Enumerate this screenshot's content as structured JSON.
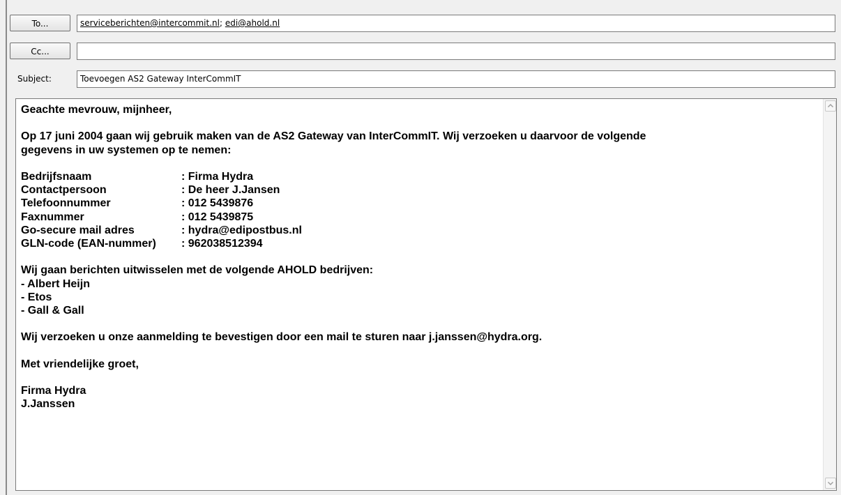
{
  "header": {
    "to_button": "To...",
    "to_recipients": [
      "serviceberichten@intercommit.nl",
      "edi@ahold.nl"
    ],
    "to_separator": "; ",
    "cc_button": "Cc...",
    "cc_value": "",
    "subject_label": "Subject:",
    "subject_value": "Toevoegen AS2 Gateway InterCommIT"
  },
  "message": {
    "greeting": "Geachte mevrouw, mijnheer,",
    "intro_line1": "Op 17 juni 2004 gaan wij gebruik maken van de AS2 Gateway van InterCommIT. Wij verzoeken u daarvoor de volgende",
    "intro_line2": "gegevens in uw systemen op te nemen:",
    "details": [
      {
        "key": "Bedrijfsnaam",
        "value": ": Firma Hydra"
      },
      {
        "key": "Contactpersoon",
        "value": ": De heer J.Jansen"
      },
      {
        "key": "Telefoonnummer",
        "value": ": 012 5439876"
      },
      {
        "key": "Faxnummer",
        "value": ": 012 5439875"
      },
      {
        "key": "Go-secure mail adres",
        "value": ": hydra@edipostbus.nl"
      },
      {
        "key": "GLN-code (EAN-nummer)",
        "value": ": 962038512394"
      }
    ],
    "companies_intro": "Wij gaan berichten uitwisselen met de volgende AHOLD bedrijven:",
    "companies": [
      "- Albert Heijn",
      "- Etos",
      "- Gall & Gall"
    ],
    "confirm": "Wij verzoeken u onze aanmelding te bevestigen door een mail te sturen naar j.janssen@hydra.org.",
    "closing": "Met vriendelijke groet,",
    "signature_company": "Firma Hydra",
    "signature_name": "J.Janssen"
  },
  "scrollbar": {
    "up_icon": "chevron-up-icon",
    "down_icon": "chevron-down-icon"
  }
}
